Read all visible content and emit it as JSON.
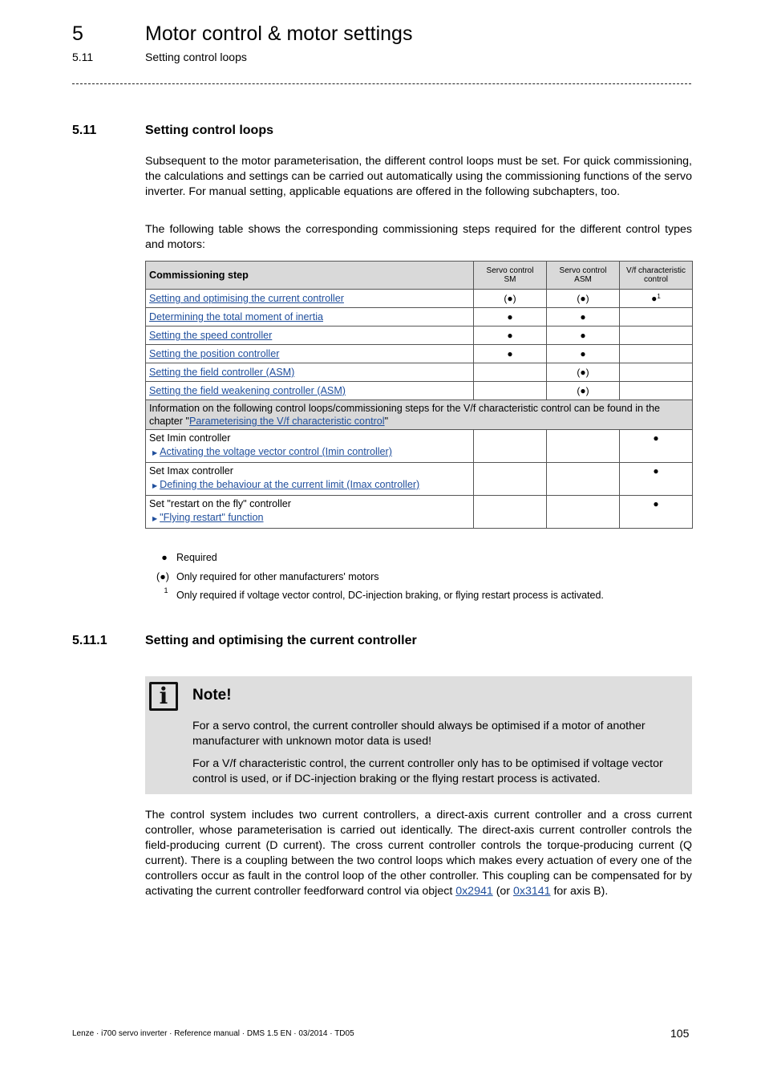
{
  "header": {
    "chapter_number": "5",
    "chapter_title": "Motor control & motor settings",
    "section_number": "5.11",
    "section_title": "Setting control loops"
  },
  "section": {
    "number": "5.11",
    "title": "Setting control loops",
    "paragraphs": [
      "Subsequent to the motor parameterisation, the different control loops must be set. For quick commissioning, the calculations and settings can be carried out automatically using the commissioning functions of the servo inverter. For manual setting, applicable equations are offered in the following subchapters, too.",
      "The following table shows the corresponding commissioning steps required for the different control types and motors:"
    ]
  },
  "table": {
    "headers": [
      "Commissioning step",
      "Servo control SM",
      "Servo control ASM",
      "V/f characteristic control"
    ],
    "header_lines": {
      "sm": [
        "Servo control",
        "SM"
      ],
      "asm": [
        "Servo control",
        "ASM"
      ],
      "vf": [
        "V/f characteristic",
        "control"
      ]
    },
    "rows": [
      {
        "step": "Setting and optimising the current controller",
        "sm": "(●)",
        "asm": "(●)",
        "vf": "●",
        "vf_footnote": "1"
      },
      {
        "step": "Determining the total moment of inertia",
        "sm": "●",
        "asm": "●",
        "vf": ""
      },
      {
        "step": "Setting the speed controller",
        "sm": "●",
        "asm": "●",
        "vf": ""
      },
      {
        "step": "Setting the position controller",
        "sm": "●",
        "asm": "●",
        "vf": ""
      },
      {
        "step": "Setting the field controller (ASM)",
        "sm": "",
        "asm": "(●)",
        "vf": ""
      },
      {
        "step": "Setting the field weakening controller (ASM)",
        "sm": "",
        "asm": "(●)",
        "vf": ""
      }
    ],
    "info_row": {
      "text_before": "Information on the following control loops/commissioning steps for the V/f characteristic control can be found in the chapter \"",
      "link": "Parameterising the V/f characteristic control",
      "text_after": "\""
    },
    "vf_rows": [
      {
        "step": "Set Imin controller",
        "link": "Activating the voltage vector control (Imin controller)",
        "sm": "",
        "asm": "",
        "vf": "●"
      },
      {
        "step": "Set Imax controller",
        "link": "Defining the behaviour at the current limit (Imax controller)",
        "sm": "",
        "asm": "",
        "vf": "●"
      },
      {
        "step": "Set \"restart on the fly\" controller",
        "link": "\"Flying restart\" function",
        "sm": "",
        "asm": "",
        "vf": "●"
      }
    ]
  },
  "legend": [
    {
      "symbol": "●",
      "text": "Required"
    },
    {
      "symbol": "(●)",
      "text": "Only required for other manufacturers' motors"
    },
    {
      "symbol": "1",
      "text": "Only required if voltage vector control, DC-injection braking, or flying restart process is activated."
    }
  ],
  "subsection": {
    "number": "5.11.1",
    "title": "Setting and optimising the current controller"
  },
  "note": {
    "icon": "info-icon",
    "icon_glyph": "i",
    "title": "Note!",
    "paragraphs": [
      "For a servo control, the current controller should always be optimised if a motor of another manufacturer with unknown motor data is used!",
      "For a V/f characteristic control, the current controller only has to be optimised if voltage vector control is used, or if DC-injection braking or the flying restart process is activated."
    ]
  },
  "body": {
    "text_before": "The control system includes two current controllers, a direct-axis current controller and a cross current controller, whose parameterisation is carried out identically. The direct-axis current controller controls the field-producing current (D current). The cross current controller controls the torque-producing current (Q current). There is a coupling between the two control loops which makes every actuation of every one of the controllers occur as fault in the control loop of the other controller. This coupling can be compensated for by activating the current controller feedforward control via object ",
    "link1": "0x2941",
    "text_middle": " (or ",
    "link2": "0x3141",
    "text_after": " for axis B)."
  },
  "footer": {
    "text": "Lenze · i700 servo inverter · Reference manual · DMS 1.5 EN · 03/2014 · TD05",
    "page_number": "105"
  },
  "colors": {
    "link": "#1f4e9c",
    "table_header_bg": "#d9d9d9",
    "note_bg": "#dedede"
  }
}
